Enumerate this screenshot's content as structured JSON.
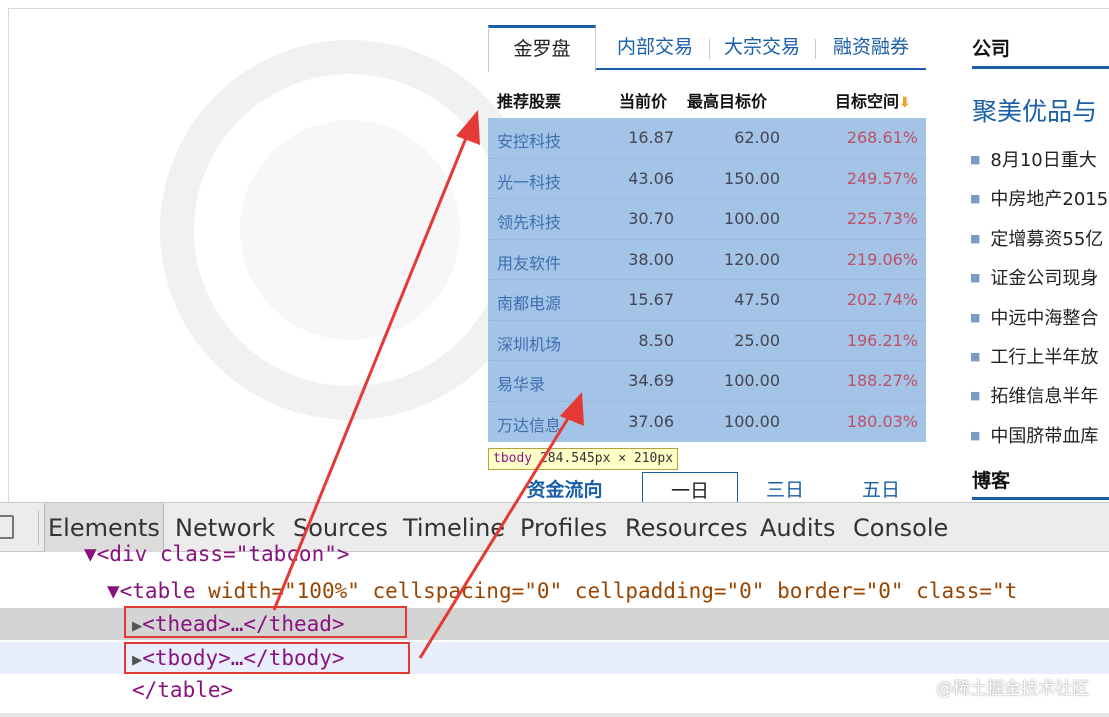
{
  "tabs": [
    {
      "label": "金罗盘",
      "active": true
    },
    {
      "label": "内部交易",
      "active": false
    },
    {
      "label": "大宗交易",
      "active": false
    },
    {
      "label": "融资融券",
      "active": false
    }
  ],
  "table": {
    "headers": {
      "name": "推荐股票",
      "price": "当前价",
      "target": "最高目标价",
      "space": "目标空间"
    },
    "rows": [
      {
        "name": "安控科技",
        "price": "16.87",
        "target": "62.00",
        "space": "268.61%"
      },
      {
        "name": "光一科技",
        "price": "43.06",
        "target": "150.00",
        "space": "249.57%"
      },
      {
        "name": "领先科技",
        "price": "30.70",
        "target": "100.00",
        "space": "225.73%"
      },
      {
        "name": "用友软件",
        "price": "38.00",
        "target": "120.00",
        "space": "219.06%"
      },
      {
        "name": "南都电源",
        "price": "15.67",
        "target": "47.50",
        "space": "202.74%"
      },
      {
        "name": "深圳机场",
        "price": "8.50",
        "target": "25.00",
        "space": "196.21%"
      },
      {
        "name": "易华录",
        "price": "34.69",
        "target": "100.00",
        "space": "188.27%"
      },
      {
        "name": "万达信息",
        "price": "37.06",
        "target": "100.00",
        "space": "180.03%"
      }
    ]
  },
  "tooltip": {
    "tag": "tbody",
    "size": "284.545px × 210px"
  },
  "flow": {
    "title": "资金流向",
    "tabs": [
      "一日",
      "三日",
      "五日"
    ]
  },
  "right": {
    "heading": "公司",
    "title": "聚美优品与",
    "news": [
      "8月10日重大",
      "中房地产2015",
      "定增募资55亿",
      "证金公司现身",
      "中远中海整合",
      "工行上半年放",
      "拓维信息半年",
      "中国脐带血库"
    ],
    "blog_heading": "博客"
  },
  "devtools": {
    "tabs": [
      "Elements",
      "Network",
      "Sources",
      "Timeline",
      "Profiles",
      "Resources",
      "Audits",
      "Console"
    ],
    "lines": {
      "l1": "▼<div class=\"tabcon\">",
      "l2_tag_open": "▼<table ",
      "l2_attrs": "width=\"100%\" cellspacing=\"0\" cellpadding=\"0\" border=\"0\" class=\"t",
      "l3": "<thead>…</thead>",
      "l4": "<tbody>…</tbody>",
      "l5": "</table>"
    }
  },
  "credit": "@稀土掘金技术社区",
  "colors": {
    "accent": "#1a5ea8",
    "highlight": "#a3c4e6",
    "annotation": "#e53935",
    "tag": "#881280"
  }
}
